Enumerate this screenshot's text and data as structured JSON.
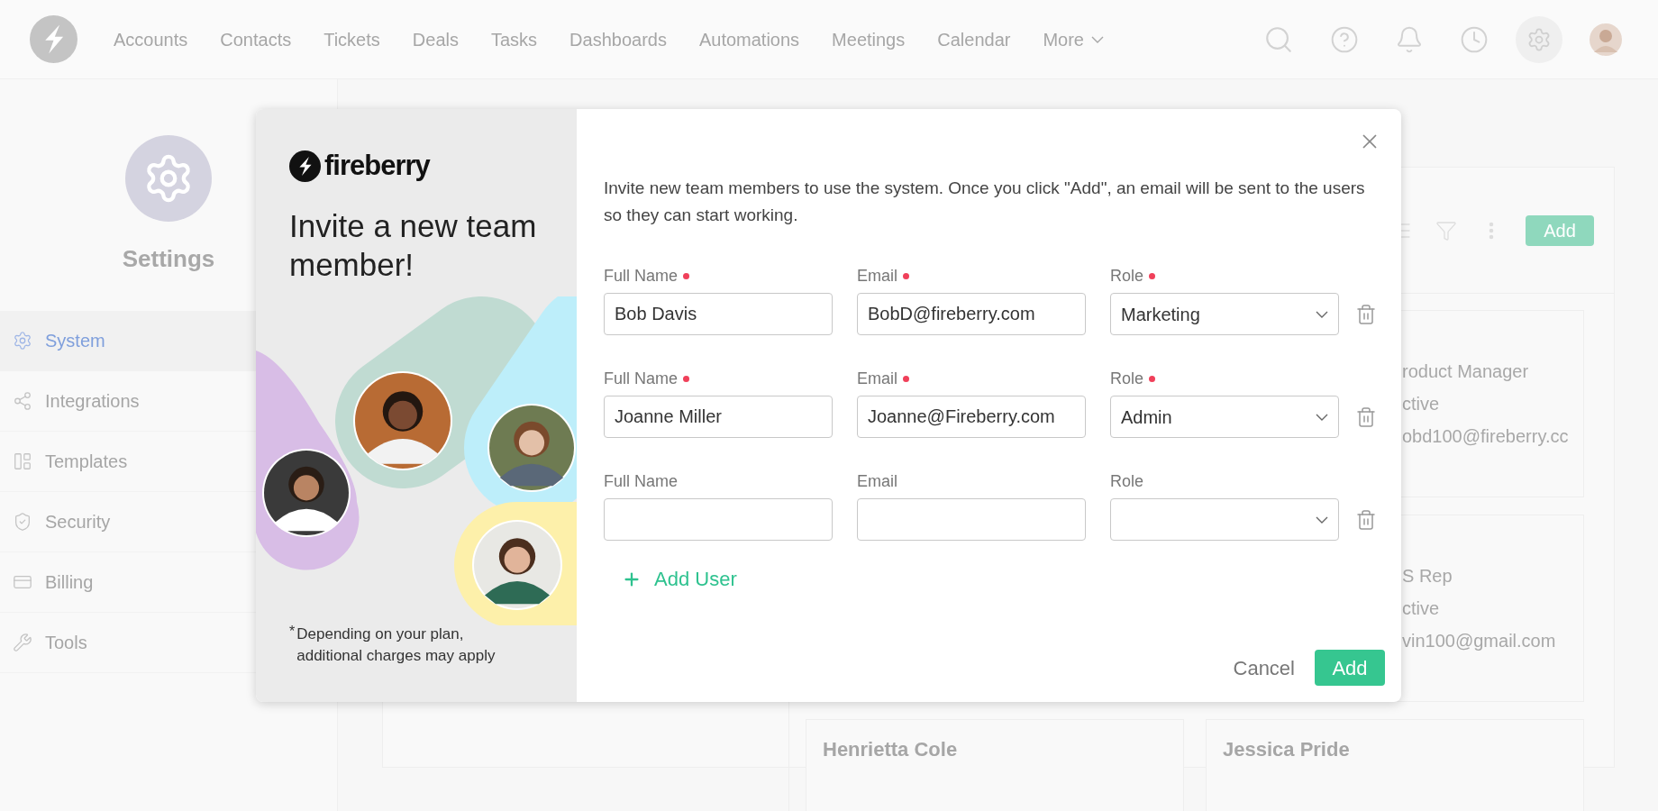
{
  "nav": {
    "items": [
      {
        "label": "Accounts"
      },
      {
        "label": "Contacts"
      },
      {
        "label": "Tickets"
      },
      {
        "label": "Deals"
      },
      {
        "label": "Tasks"
      },
      {
        "label": "Dashboards"
      },
      {
        "label": "Automations"
      },
      {
        "label": "Meetings"
      },
      {
        "label": "Calendar"
      }
    ],
    "more": "More"
  },
  "sidebar": {
    "title": "Settings",
    "items": [
      {
        "label": "System",
        "selected": true
      },
      {
        "label": "Integrations",
        "selected": false
      },
      {
        "label": "Templates",
        "selected": false
      },
      {
        "label": "Security",
        "selected": false
      },
      {
        "label": "Billing",
        "selected": false
      },
      {
        "label": "Tools",
        "selected": false
      }
    ]
  },
  "board": {
    "add": "Add",
    "right_cards": [
      {
        "lines": [
          "roduct Manager",
          "ctive",
          "obd100@fireberry.cc"
        ]
      },
      {
        "lines": [
          "S Rep",
          "ctive",
          "vin100@gmail.com"
        ]
      },
      {
        "name": "Jessica Pride"
      }
    ],
    "middle_card": {
      "name": "Henrietta Cole"
    }
  },
  "modal": {
    "brand": "fireberry",
    "heading": "Invite a new team member!",
    "footnote_mark": "*",
    "footnote": "Depending on your plan, additional charges may apply",
    "description": "Invite new team members to use the system. Once you click \"Add\", an email will be sent to the users so they can start working.",
    "rows": [
      {
        "fields": [
          {
            "kind": "text",
            "label": "Full Name",
            "required": true,
            "value": "Bob Davis"
          },
          {
            "kind": "text",
            "label": "Email",
            "required": true,
            "value": "BobD@fireberry.com"
          },
          {
            "kind": "select",
            "label": "Role",
            "required": true,
            "value": "Marketing"
          }
        ]
      },
      {
        "fields": [
          {
            "kind": "text",
            "label": "Full Name",
            "required": true,
            "value": "Joanne Miller"
          },
          {
            "kind": "text",
            "label": "Email",
            "required": true,
            "value": "Joanne@Fireberry.com"
          },
          {
            "kind": "select",
            "label": "Role",
            "required": true,
            "value": "Admin"
          }
        ]
      },
      {
        "fields": [
          {
            "kind": "text",
            "label": "Full Name",
            "required": false
          },
          {
            "kind": "text",
            "label": "Email",
            "required": false
          },
          {
            "kind": "select",
            "label": "Role",
            "required": false
          }
        ]
      }
    ],
    "add_user": "Add User",
    "cancel": "Cancel",
    "submit": "Add"
  }
}
